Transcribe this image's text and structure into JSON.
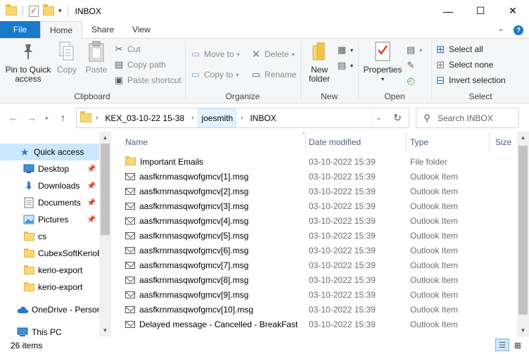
{
  "window": {
    "title": "INBOX",
    "minimize": "—",
    "maximize": "☐",
    "close": "✕"
  },
  "ribbon_tabs": [
    {
      "label": "File"
    },
    {
      "label": "Home"
    },
    {
      "label": "Share"
    },
    {
      "label": "View"
    }
  ],
  "ribbon": {
    "clipboard": {
      "label": "Clipboard",
      "pin": "Pin to Quick access",
      "pin_line1": "Pin to Quick",
      "pin_line2": "access",
      "copy": "Copy",
      "paste": "Paste",
      "cut": "Cut",
      "copy_path": "Copy path",
      "paste_shortcut": "Paste shortcut"
    },
    "organize": {
      "label": "Organize",
      "move_to": "Move to",
      "copy_to": "Copy to",
      "delete": "Delete",
      "rename": "Rename"
    },
    "new": {
      "label": "New",
      "new_folder_line1": "New",
      "new_folder_line2": "folder"
    },
    "open": {
      "label": "Open",
      "properties": "Properties"
    },
    "select": {
      "label": "Select",
      "select_all": "Select all",
      "select_none": "Select none",
      "invert": "Invert selection"
    }
  },
  "address": {
    "crumbs": [
      "KEX_03-10-22 15-38",
      "joesmith",
      "INBOX"
    ],
    "search_placeholder": "Search INBOX"
  },
  "nav_pane": {
    "items": [
      {
        "label": "Quick access",
        "icon": "star-icon"
      },
      {
        "label": "Desktop",
        "icon": "desktop-icon",
        "pinned": true
      },
      {
        "label": "Downloads",
        "icon": "download-icon",
        "pinned": true
      },
      {
        "label": "Documents",
        "icon": "documents-icon",
        "pinned": true
      },
      {
        "label": "Pictures",
        "icon": "pictures-icon",
        "pinned": true
      },
      {
        "label": "cs",
        "icon": "folder-icon"
      },
      {
        "label": "CubexSoftKerioE",
        "icon": "folder-icon"
      },
      {
        "label": "kerio-export",
        "icon": "folder-icon"
      },
      {
        "label": "kerio-export",
        "icon": "folder-icon"
      },
      {
        "label": "OneDrive - Persor",
        "icon": "cloud-icon"
      },
      {
        "label": "This PC",
        "icon": "computer-icon"
      }
    ]
  },
  "columns": {
    "name": "Name",
    "date": "Date modified",
    "type": "Type",
    "size": "Size"
  },
  "files": [
    {
      "name": "Important Emails",
      "date": "03-10-2022 15:39",
      "type": "File folder",
      "kind": "folder"
    },
    {
      "name": "aasfkrnmasqwofgmcv[1].msg",
      "date": "03-10-2022 15:39",
      "type": "Outlook Item",
      "kind": "mail"
    },
    {
      "name": "aasfkrnmasqwofgmcv[2].msg",
      "date": "03-10-2022 15:39",
      "type": "Outlook Item",
      "kind": "mail"
    },
    {
      "name": "aasfkrnmasqwofgmcv[3].msg",
      "date": "03-10-2022 15:39",
      "type": "Outlook Item",
      "kind": "mail"
    },
    {
      "name": "aasfkrnmasqwofgmcv[4].msg",
      "date": "03-10-2022 15:39",
      "type": "Outlook Item",
      "kind": "mail"
    },
    {
      "name": "aasfkrnmasqwofgmcv[5].msg",
      "date": "03-10-2022 15:39",
      "type": "Outlook Item",
      "kind": "mail"
    },
    {
      "name": "aasfkrnmasqwofgmcv[6].msg",
      "date": "03-10-2022 15:39",
      "type": "Outlook Item",
      "kind": "mail"
    },
    {
      "name": "aasfkrnmasqwofgmcv[7].msg",
      "date": "03-10-2022 15:39",
      "type": "Outlook Item",
      "kind": "mail"
    },
    {
      "name": "aasfkrnmasqwofgmcv[8].msg",
      "date": "03-10-2022 15:39",
      "type": "Outlook Item",
      "kind": "mail"
    },
    {
      "name": "aasfkrnmasqwofgmcv[9].msg",
      "date": "03-10-2022 15:39",
      "type": "Outlook Item",
      "kind": "mail"
    },
    {
      "name": "aasfkrnmasqwofgmcv[10].msg",
      "date": "03-10-2022 15:39",
      "type": "Outlook Item",
      "kind": "mail"
    },
    {
      "name": "Delayed message - Cancelled - BreakFast",
      "date": "03-10-2022 15:39",
      "type": "Outlook Item",
      "kind": "mail"
    }
  ],
  "status": {
    "count": "26 items"
  },
  "colors": {
    "accent": "#1979ca",
    "selection": "#cce8ff",
    "ribbon_bg": "#f5f6f7"
  }
}
